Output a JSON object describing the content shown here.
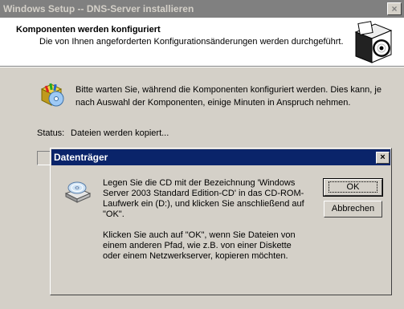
{
  "main_window": {
    "title": "Windows Setup -- DNS-Server installieren",
    "close_glyph": "×",
    "header": {
      "title": "Komponenten werden konfiguriert",
      "subtitle": "Die von Ihnen angeforderten Konfigurationsänderungen werden durchgeführt."
    },
    "message": "Bitte warten Sie, während die Komponenten konfiguriert werden. Dies kann, je nach Auswahl der Komponenten, einige Minuten in Anspruch nehmen.",
    "status_label": "Status:",
    "status_value": "Dateien werden kopiert..."
  },
  "dialog": {
    "title": "Datenträger",
    "close_glyph": "×",
    "message_1": "Legen Sie die CD mit der Bezeichnung 'Windows Server 2003 Standard Edition-CD' in das CD-ROM-Laufwerk ein (D:), und klicken Sie anschließend auf \"OK\".",
    "message_2": "Klicken Sie auch auf \"OK\", wenn Sie Dateien von einem anderen Pfad, wie z.B. von einer Diskette oder einem Netzwerkserver, kopieren möchten.",
    "ok_label": "OK",
    "cancel_label": "Abbrechen"
  },
  "icons": {
    "install": "setup-box-cd-icon",
    "wizard": "components-icon",
    "cd": "cd-drive-icon"
  },
  "colors": {
    "titlebar_active": "#0a246a",
    "titlebar_inactive": "#808080",
    "face": "#d4d0c8"
  }
}
